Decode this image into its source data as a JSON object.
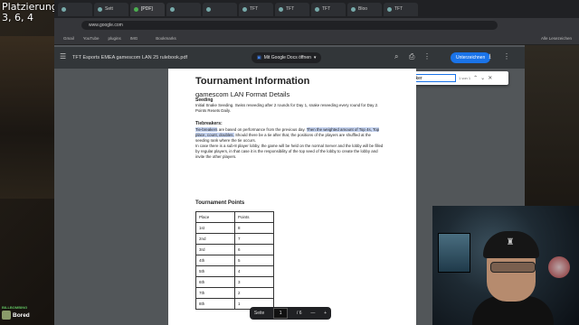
{
  "overlay": {
    "title": "Platzierungen:",
    "values": "3, 6, 4"
  },
  "browser": {
    "tabs": [
      "",
      "Sett",
      "[PDF]",
      "",
      "",
      "TFT",
      "TFT",
      "TFT",
      "Bloo",
      "TFT"
    ],
    "omnibox_url": "www.google.com"
  },
  "bookmarks": [
    "Gmail",
    "YouTube",
    "plugins",
    "IMG",
    "",
    "Bookmarks",
    "",
    "Alle Lesezeichen"
  ],
  "pdf_toolbar": {
    "title": "TFT Esports EMEA gamescom LAN 25 rulebook.pdf",
    "gdocs_button": "Mit Google Docs öffnen",
    "sign_button": "Unterzeichnen"
  },
  "find": {
    "value": "tie breaker",
    "count": "1 von 1"
  },
  "document": {
    "title": "Tournament Information",
    "subtitle": "gamescom LAN Format Details",
    "seeding_heading": "Seeding",
    "seeding_text": "Initial Snake Seeding. Swiss reseeding after 2 rounds for Day 1, snake reseeding every round for Day 2. Points Resets Daily.",
    "tiebreakers_heading": "Tiebreakers:",
    "tiebreakers_hl_1": "Tie-breakers",
    "tiebreakers_t_1": " are based on performance from the previous day. ",
    "tiebreakers_hl_2": "Then the weighted amount of Top 4s, Top place, count, doubles.",
    "tiebreakers_t_2": " Should there be a tie after that, the positions of the players are shuffled at the seeding rank where the tie occurs.",
    "tiebreakers_t_3": "In case there is a sub-8 player lobby, the game will be held on the normal Server and the lobby will be filled by regular players, in that case it is the responsibility of the top seed of the lobby to create the lobby and invite the other players.",
    "points_heading": "Tournament Points",
    "points_table": {
      "headers": [
        "Place",
        "Points"
      ],
      "rows": [
        [
          "1st",
          "8"
        ],
        [
          "2nd",
          "7"
        ],
        [
          "3rd",
          "6"
        ],
        [
          "4th",
          "5"
        ],
        [
          "5th",
          "4"
        ],
        [
          "6th",
          "3"
        ],
        [
          "7th",
          "2"
        ],
        [
          "8th",
          "1"
        ]
      ]
    }
  },
  "page_controls": {
    "label": "Seite",
    "current": "1",
    "total": "/ 6",
    "zoom_out": "—",
    "zoom_in": "+"
  },
  "chat": {
    "badge_label": "BILLBOMBING",
    "text": "Bored"
  }
}
